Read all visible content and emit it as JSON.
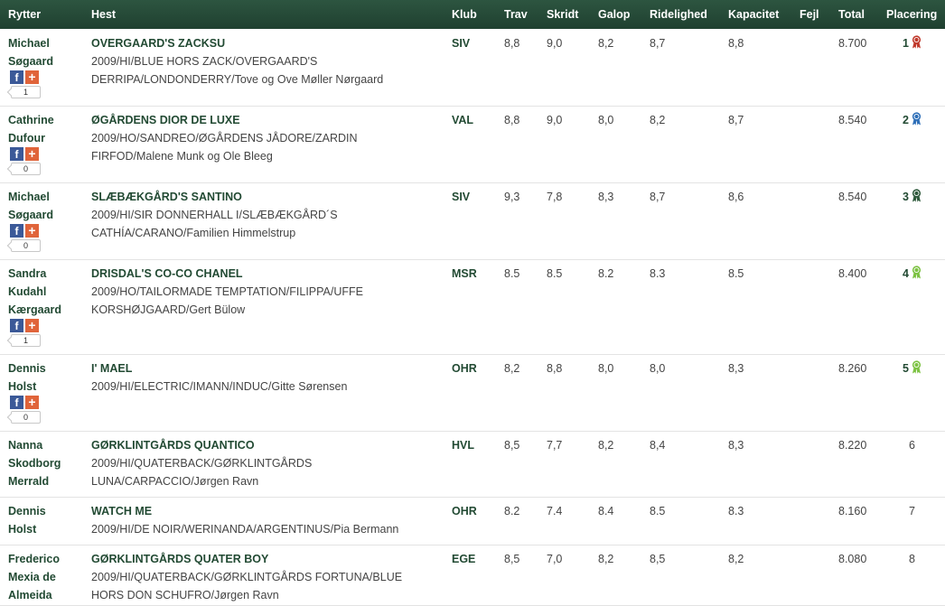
{
  "columns": [
    "Rytter",
    "Hest",
    "Klub",
    "Trav",
    "Skridt",
    "Galop",
    "Ridelighed",
    "Kapacitet",
    "Fejl",
    "Total",
    "Placering"
  ],
  "rows": [
    {
      "rider": [
        "Michael",
        "Søgaard"
      ],
      "horse_name": "OVERGAARD'S ZACKSU",
      "horse_lines": [
        "2009/HI/BLUE HORS ZACK/OVERGAARD'S",
        "DERRIPA/LONDONDERRY/Tove og Ove Møller Nørgaard"
      ],
      "club": "SIV",
      "trav": "8,8",
      "skridt": "9,0",
      "galop": "8,2",
      "ridelighed": "8,7",
      "kapacitet": "8,8",
      "fejl": "",
      "total": "8.700",
      "placering": "1",
      "ribbon": "#c0392b",
      "share_count": "1"
    },
    {
      "rider": [
        "Cathrine",
        "Dufour"
      ],
      "horse_name": "ØGÅRDENS DIOR DE LUXE",
      "horse_lines": [
        "2009/HO/SANDREO/ØGÅRDENS JÅDORE/ZARDIN",
        "FIRFOD/Malene Munk og Ole Bleeg"
      ],
      "club": "VAL",
      "trav": "8,8",
      "skridt": "9,0",
      "galop": "8,0",
      "ridelighed": "8,2",
      "kapacitet": "8,7",
      "fejl": "",
      "total": "8.540",
      "placering": "2",
      "ribbon": "#2e6fb8",
      "share_count": "0"
    },
    {
      "rider": [
        "Michael",
        "Søgaard"
      ],
      "horse_name": "SLÆBÆKGÅRD'S SANTINO",
      "horse_lines": [
        "2009/HI/SIR DONNERHALL I/SLÆBÆKGÅRD´S",
        "CATHÍA/CARANO/Familien Himmelstrup"
      ],
      "club": "SIV",
      "trav": "9,3",
      "skridt": "7,8",
      "galop": "8,3",
      "ridelighed": "8,7",
      "kapacitet": "8,6",
      "fejl": "",
      "total": "8.540",
      "placering": "3",
      "ribbon": "#2f5a3c",
      "share_count": "0"
    },
    {
      "rider": [
        "Sandra",
        "Kudahl",
        "Kærgaard"
      ],
      "horse_name": "DRISDAL'S CO-CO CHANEL",
      "horse_lines": [
        "2009/HO/TAILORMADE TEMPTATION/FILIPPA/UFFE",
        "KORSHØJGAARD/Gert Bülow"
      ],
      "club": "MSR",
      "trav": "8.5",
      "skridt": "8.5",
      "galop": "8.2",
      "ridelighed": "8.3",
      "kapacitet": "8.5",
      "fejl": "",
      "total": "8.400",
      "placering": "4",
      "ribbon": "#7cc242",
      "share_count": "1"
    },
    {
      "rider": [
        "Dennis",
        "Holst"
      ],
      "horse_name": "I' MAEL",
      "horse_lines": [
        "2009/HI/ELECTRIC/IMANN/INDUC/Gitte Sørensen"
      ],
      "club": "OHR",
      "trav": "8,2",
      "skridt": "8,8",
      "galop": "8,0",
      "ridelighed": "8,0",
      "kapacitet": "8,3",
      "fejl": "",
      "total": "8.260",
      "placering": "5",
      "ribbon": "#7cc242",
      "share_count": "0"
    },
    {
      "rider": [
        "Nanna",
        "Skodborg",
        "Merrald"
      ],
      "horse_name": "GØRKLINTGÅRDS QUANTICO",
      "horse_lines": [
        "2009/HI/QUATERBACK/GØRKLINTGÅRDS",
        "LUNA/CARPACCIO/Jørgen Ravn"
      ],
      "club": "HVL",
      "trav": "8,5",
      "skridt": "7,7",
      "galop": "8,2",
      "ridelighed": "8,4",
      "kapacitet": "8,3",
      "fejl": "",
      "total": "8.220",
      "placering": "6",
      "ribbon": "",
      "share_count": ""
    },
    {
      "rider": [
        "Dennis",
        "Holst"
      ],
      "horse_name": "WATCH ME",
      "horse_lines": [
        "2009/HI/DE NOIR/WERINANDA/ARGENTINUS/Pia Bermann"
      ],
      "club": "OHR",
      "trav": "8.2",
      "skridt": "7.4",
      "galop": "8.4",
      "ridelighed": "8.5",
      "kapacitet": "8.3",
      "fejl": "",
      "total": "8.160",
      "placering": "7",
      "ribbon": "",
      "share_count": ""
    },
    {
      "rider": [
        "Frederico",
        "Mexia de",
        "Almeida"
      ],
      "horse_name": "GØRKLINTGÅRDS QUATER BOY",
      "horse_lines": [
        "2009/HI/QUATERBACK/GØRKLINTGÅRDS FORTUNA/BLUE",
        "HORS DON SCHUFRO/Jørgen Ravn"
      ],
      "club": "EGE",
      "trav": "8,5",
      "skridt": "7,0",
      "galop": "8,2",
      "ridelighed": "8,5",
      "kapacitet": "8,2",
      "fejl": "",
      "total": "8.080",
      "placering": "8",
      "ribbon": "",
      "share_count": ""
    }
  ]
}
